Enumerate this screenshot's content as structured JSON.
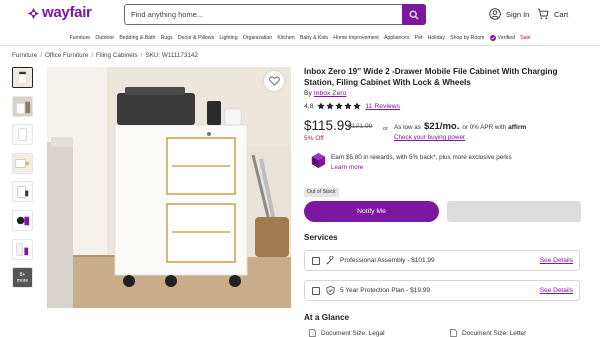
{
  "brand": {
    "name": "wayfair",
    "color": "#7b189f"
  },
  "header": {
    "search_placeholder": "Find anything home...",
    "signin_label": "Sign In",
    "cart_label": "Cart"
  },
  "nav": {
    "items": [
      "Furniture",
      "Outdoor",
      "Bedding & Bath",
      "Rugs",
      "Decor & Pillows",
      "Lighting",
      "Organization",
      "Kitchen",
      "Baby & Kids",
      "Home Improvement",
      "Appliances",
      "Pet",
      "Holiday",
      "Shop by Room"
    ],
    "verified": "Verified",
    "sale": "Sale"
  },
  "breadcrumb": {
    "items": [
      "Furniture",
      "Office Furniture",
      "Filing Cabinets"
    ],
    "sku": "SKU: W111173142"
  },
  "gallery": {
    "more_label": "more",
    "more_count": "8+"
  },
  "product": {
    "title": "Inbox Zero 19'' Wide 2 -Drawer Mobile File Cabinet With Charging Station, Filing Cabinet With Lock & Wheels",
    "by_label": "By",
    "brand": "Inbox Zero",
    "rating": "4.8",
    "stars": 5,
    "reviews": "11 Reviews",
    "price": "$115.99",
    "old_price": "$121.99",
    "discount": "5% Off",
    "or_label": "or",
    "financing_prefix": "As low as",
    "financing_amount": "$21/mo.",
    "financing_suffix": "or 0% APR with",
    "financing_brand": "affirm",
    "financing_link": "Check your buying power",
    "rewards_text": "Earn $5.80 in rewards, with 5% back*, plus more exclusive perks",
    "rewards_link": "Learn more",
    "stock_badge": "Out of Stock",
    "notify_label": "Notify Me"
  },
  "services": {
    "heading": "Services",
    "items": [
      {
        "label": "Professional Assembly - $101.99",
        "link": "See Details"
      },
      {
        "label": "5 Year Protection Plan - $19.99",
        "link": "See Details"
      }
    ]
  },
  "glance": {
    "heading": "At a Glance",
    "items": [
      "Document Size: Legal",
      "Document Size: Letter"
    ]
  },
  "icons": {
    "search": "search-icon",
    "user": "user-icon",
    "cart": "cart-icon",
    "heart": "heart-icon",
    "star": "star-icon",
    "shield": "shield-icon",
    "wrench": "assembly-icon",
    "document": "document-icon"
  }
}
